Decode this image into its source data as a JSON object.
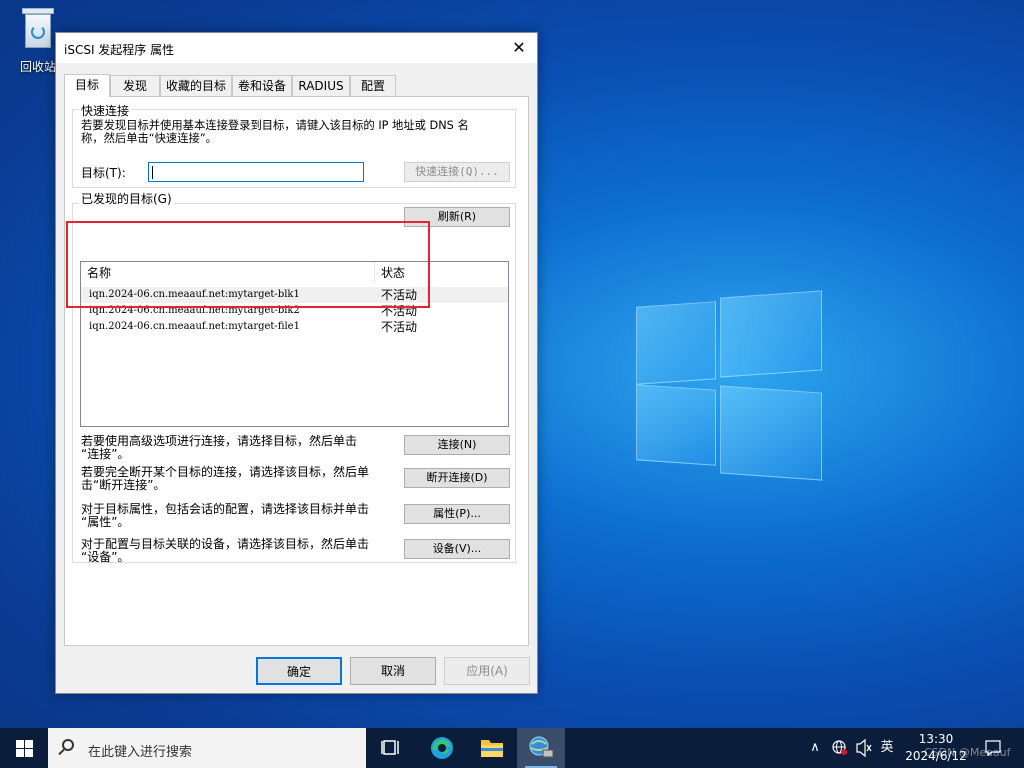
{
  "desktop": {
    "recycle_bin_label": "回收站"
  },
  "dialog": {
    "title": "iSCSI 发起程序 属性",
    "close_glyph": "✕",
    "tabs": [
      "目标",
      "发现",
      "收藏的目标",
      "卷和设备",
      "RADIUS",
      "配置"
    ],
    "active_tab": "目标",
    "quick_connect": {
      "group_title": "快速连接",
      "description_line1": "若要发现目标并使用基本连接登录到目标，请键入该目标的 IP 地址或 DNS 名",
      "description_line2": "称，然后单击“快速连接”。",
      "target_label": "目标(T):",
      "target_value": "",
      "button": "快速连接(Q)..."
    },
    "discovered": {
      "group_title": "已发现的目标(G)",
      "refresh_button": "刷新(R)",
      "columns": [
        "名称",
        "状态"
      ],
      "rows": [
        {
          "name": "iqn.2024-06.cn.meaauf.net:mytarget-blk1",
          "status": "不活动"
        },
        {
          "name": "iqn.2024-06.cn.meaauf.net:mytarget-blk2",
          "status": "不活动"
        },
        {
          "name": "iqn.2024-06.cn.meaauf.net:mytarget-file1",
          "status": "不活动"
        }
      ]
    },
    "actions": [
      {
        "line1": "若要使用高级选项进行连接，请选择目标，然后单击",
        "line2": "“连接”。",
        "button": "连接(N)"
      },
      {
        "line1": "若要完全断开某个目标的连接，请选择该目标，然后单",
        "line2": "击“断开连接”。",
        "button": "断开连接(D)"
      },
      {
        "line1": "对于目标属性，包括会话的配置，请选择该目标并单击",
        "line2": "“属性”。",
        "button": "属性(P)..."
      },
      {
        "line1": "对于配置与目标关联的设备，请选择该目标，然后单击",
        "line2": "“设备”。",
        "button": "设备(V)..."
      }
    ],
    "buttons": {
      "ok": "确定",
      "cancel": "取消",
      "apply": "应用(A)"
    }
  },
  "taskbar": {
    "search_placeholder": "在此键入进行搜索",
    "ime": "英",
    "time": "13:30",
    "date": "2024/6/12",
    "tray_chevron": "∧",
    "pinned": [
      "task-view",
      "edge",
      "file-explorer",
      "iscsi-initiator"
    ]
  },
  "watermark": "CSDN @Meaauf",
  "colors": {
    "accent": "#0078d7",
    "highlight_box": "#e0262e",
    "taskbar": "#0a1e3c"
  }
}
